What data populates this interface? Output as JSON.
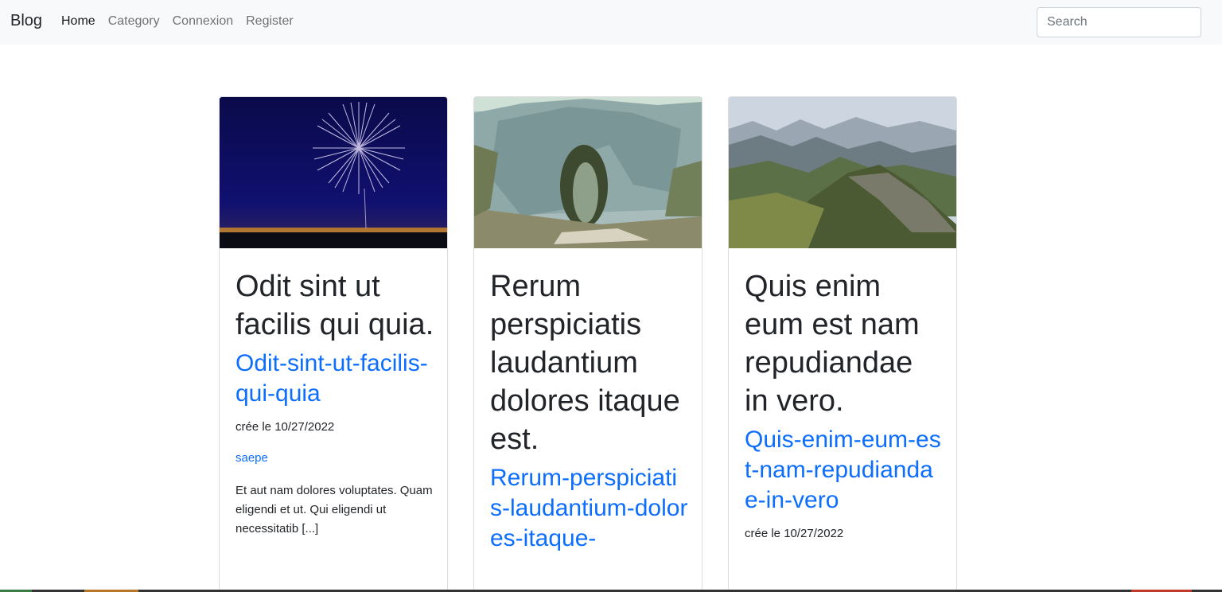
{
  "navbar": {
    "brand": "Blog",
    "links": [
      {
        "label": "Home",
        "active": true
      },
      {
        "label": "Category",
        "active": false
      },
      {
        "label": "Connexion",
        "active": false
      },
      {
        "label": "Register",
        "active": false
      }
    ],
    "search_placeholder": "Search"
  },
  "posts": [
    {
      "image": "fireworks-over-city-night",
      "title": "Odit sint ut facilis qui quia.",
      "slug": "Odit-sint-ut-facilis-qui-quia",
      "date": "crée le 10/27/2022",
      "category": "saepe",
      "excerpt": "Et aut nam dolores voluptates. Quam eligendi et ut. Qui eligendi ut necessitatib [...]"
    },
    {
      "image": "rock-arch-landscape",
      "title": "Rerum perspiciatis laudantium dolores itaque est.",
      "slug": "Rerum-perspiciatis-laudantium-dolores-itaque-"
    },
    {
      "image": "mountain-ridge-landscape",
      "title": "Quis enim eum est nam repudiandae in vero.",
      "slug": "Quis-enim-eum-est-nam-repudiandae-in-vero",
      "date": "crée le 10/27/2022"
    }
  ],
  "colors": {
    "link": "#0d6efd",
    "navbar_bg": "#f8f9fa",
    "text": "#212529"
  }
}
